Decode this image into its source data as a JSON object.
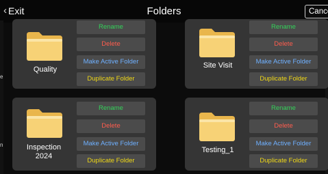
{
  "header": {
    "back_label": "Exit",
    "title": "Folders",
    "cancel_label": "Cancel"
  },
  "left_edge_letters": [
    "e",
    "n"
  ],
  "actions": {
    "rename": "Rename",
    "delete": "Delete",
    "make_active": "Make Active Folder",
    "duplicate": "Duplicate Folder"
  },
  "folders": [
    {
      "name": "Quality"
    },
    {
      "name": "Site Visit"
    },
    {
      "name": "Inspection\n2024"
    },
    {
      "name": "Testing_1"
    }
  ],
  "colors": {
    "rename": "#34d25a",
    "delete": "#ff5d4e",
    "make_active": "#6fb0ff",
    "duplicate": "#f0d816",
    "card_bg": "#353535",
    "button_bg": "#4b4b4b"
  },
  "icons": {
    "folder": "folder-icon",
    "back": "chevron-left-icon"
  }
}
